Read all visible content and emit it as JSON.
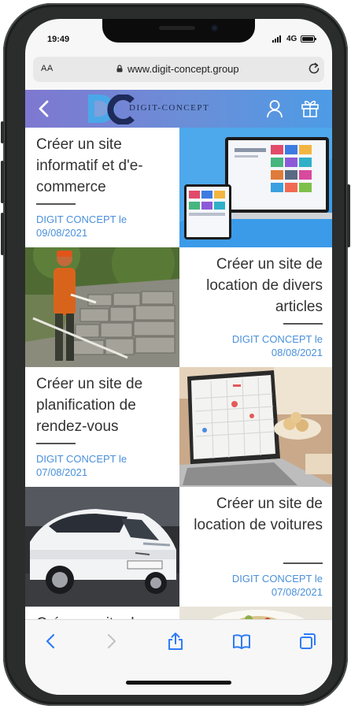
{
  "status_bar": {
    "time": "19:49",
    "network": "4G"
  },
  "browser": {
    "text_size_label": "AA",
    "url": "www.digit-concept.group"
  },
  "site_header": {
    "logo_text": "DIGIT-CONCEPT"
  },
  "articles": [
    {
      "title": "Créer un site informatif et d'e-commerce",
      "author": "DIGIT CONCEPT le",
      "date": "09/08/2021",
      "image": "laptop-website-mockup"
    },
    {
      "title": "Créer un site de location de divers articles",
      "author": "DIGIT CONCEPT le",
      "date": "08/08/2021",
      "image": "man-trimming-wall"
    },
    {
      "title": "Créer un site de planification de rendez-vous",
      "author": "DIGIT CONCEPT le",
      "date": "07/08/2021",
      "image": "laptop-calendar"
    },
    {
      "title": "Créer un site de location de voitures",
      "author": "DIGIT CONCEPT le",
      "date": "07/08/2021",
      "image": "white-car"
    },
    {
      "title": "Créer un site de",
      "author": "",
      "date": "",
      "image": "food-plate"
    }
  ],
  "toolbar": [
    "back-icon",
    "forward-icon",
    "share-icon",
    "bookmarks-icon",
    "tabs-icon"
  ],
  "colors": {
    "header_start": "#7e78d0",
    "header_end": "#4d9be6",
    "meta_blue": "#4a90d9",
    "toolbar_blue": "#2f7bf6"
  }
}
